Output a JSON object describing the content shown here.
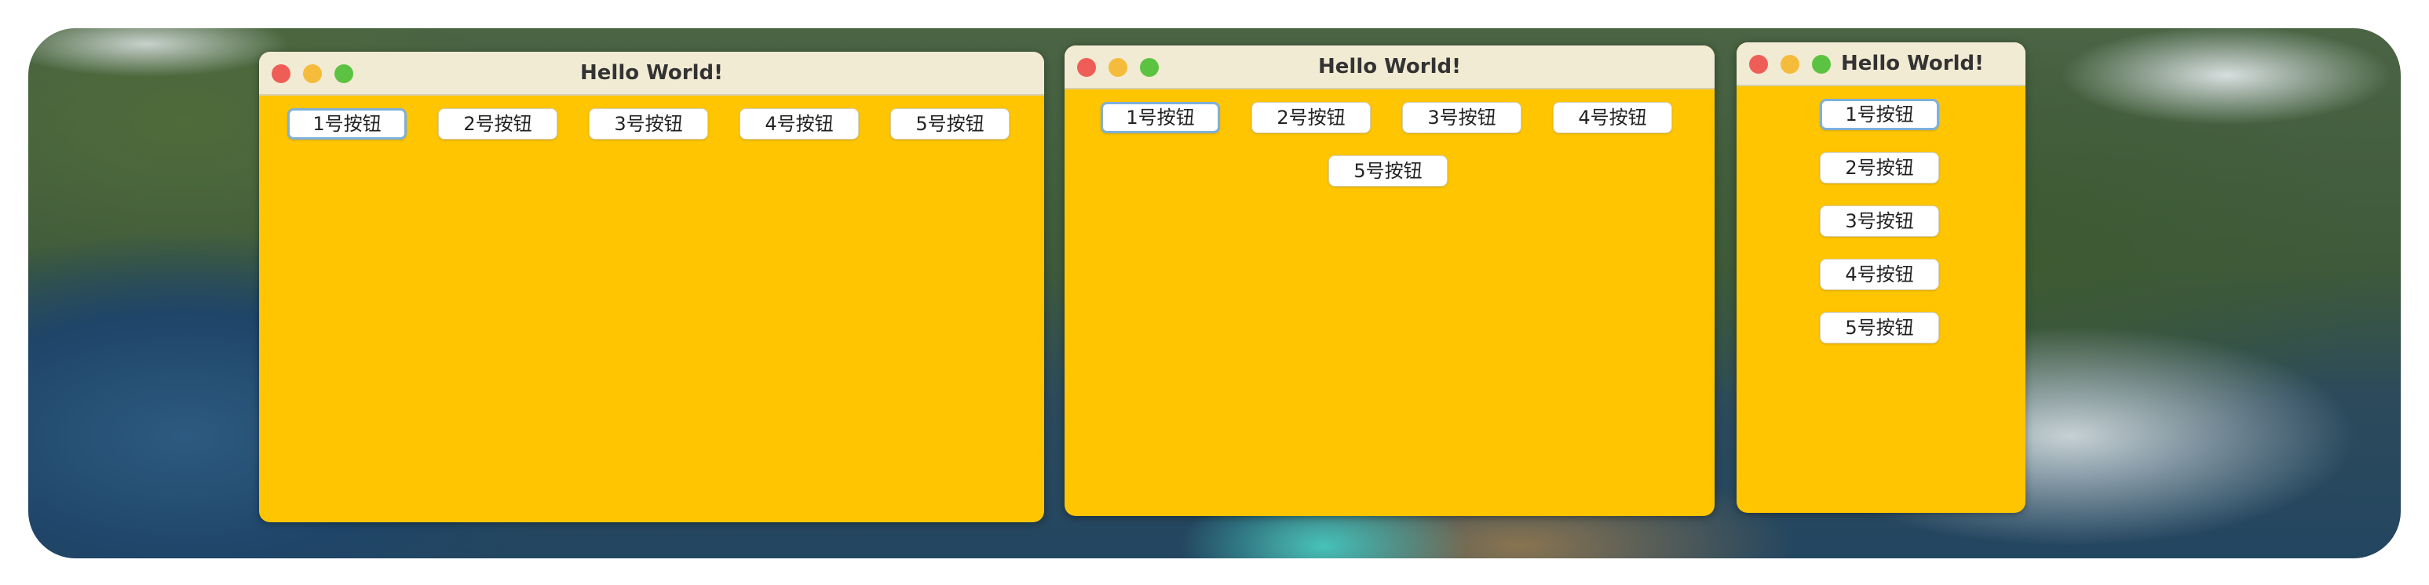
{
  "windows": [
    {
      "title": "Hello World!",
      "buttons": [
        "1号按钮",
        "2号按钮",
        "3号按钮",
        "4号按钮",
        "5号按钮"
      ]
    },
    {
      "title": "Hello World!",
      "buttons": [
        "1号按钮",
        "2号按钮",
        "3号按钮",
        "4号按钮",
        "5号按钮"
      ]
    },
    {
      "title": "Hello World!",
      "buttons": [
        "1号按钮",
        "2号按钮",
        "3号按钮",
        "4号按钮",
        "5号按钮"
      ]
    }
  ],
  "colors": {
    "window_background": "#fec500",
    "titlebar": "#f2ebd3",
    "close_light": "#ee5e57",
    "minimize_light": "#f5bc3c",
    "maximize_light": "#5cc342",
    "focus_ring": "#7eb0d9"
  }
}
